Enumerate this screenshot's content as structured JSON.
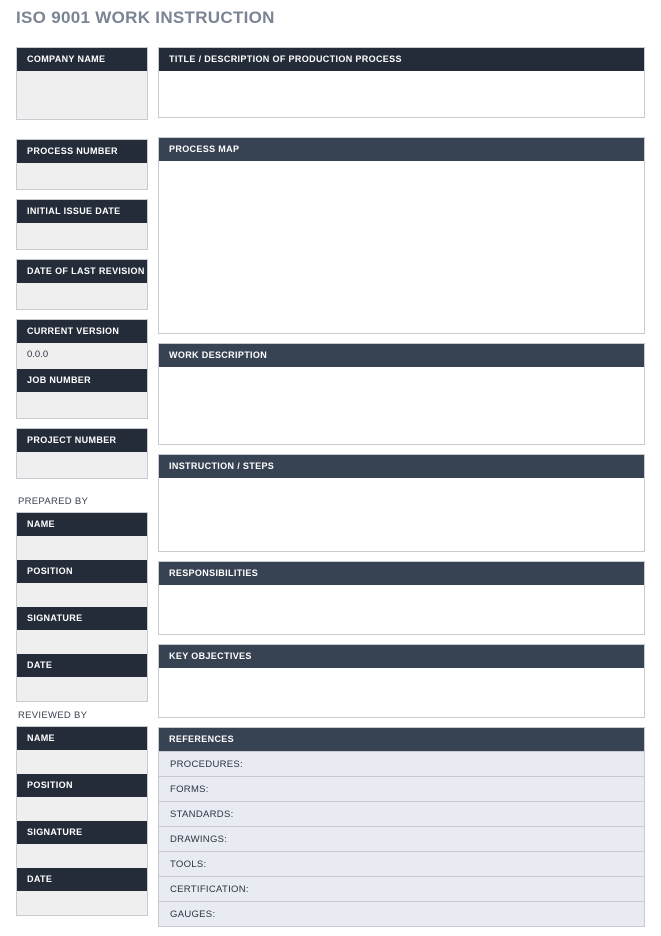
{
  "document": {
    "title": "ISO 9001 WORK INSTRUCTION"
  },
  "left_column": {
    "company": {
      "header": "COMPANY NAME",
      "value": ""
    },
    "fields": [
      {
        "header": "PROCESS NUMBER",
        "value": ""
      },
      {
        "header": "INITIAL ISSUE DATE",
        "value": ""
      },
      {
        "header": "DATE OF LAST REVISION",
        "value": ""
      },
      {
        "header": "CURRENT VERSION",
        "value": "0.0.0"
      },
      {
        "header": "JOB NUMBER",
        "value": ""
      },
      {
        "header": "PROJECT NUMBER",
        "value": ""
      }
    ],
    "prepared_by": {
      "label": "PREPARED BY",
      "rows": [
        {
          "header": "NAME",
          "value": ""
        },
        {
          "header": "POSITION",
          "value": ""
        },
        {
          "header": "SIGNATURE",
          "value": ""
        },
        {
          "header": "DATE",
          "value": ""
        }
      ]
    },
    "reviewed_by": {
      "label": "REVIEWED BY",
      "rows": [
        {
          "header": "NAME",
          "value": ""
        },
        {
          "header": "POSITION",
          "value": ""
        },
        {
          "header": "SIGNATURE",
          "value": ""
        },
        {
          "header": "DATE",
          "value": ""
        }
      ]
    }
  },
  "right_column": {
    "sections": [
      {
        "header": "TITLE / DESCRIPTION OF PRODUCTION PROCESS",
        "value": ""
      },
      {
        "header": "PROCESS MAP",
        "value": ""
      },
      {
        "header": "WORK DESCRIPTION",
        "value": ""
      },
      {
        "header": "INSTRUCTION / STEPS",
        "value": ""
      },
      {
        "header": "RESPONSIBILITIES",
        "value": ""
      },
      {
        "header": "KEY OBJECTIVES",
        "value": ""
      }
    ],
    "references": {
      "header": "REFERENCES",
      "rows": [
        {
          "label": "PROCEDURES:",
          "value": ""
        },
        {
          "label": "FORMS:",
          "value": ""
        },
        {
          "label": "STANDARDS:",
          "value": ""
        },
        {
          "label": "DRAWINGS:",
          "value": ""
        },
        {
          "label": "TOOLS:",
          "value": ""
        },
        {
          "label": "CERTIFICATION:",
          "value": ""
        },
        {
          "label": "GAUGES:",
          "value": ""
        }
      ]
    }
  },
  "colors": {
    "header_dark": "#242b39",
    "header_light": "#374253",
    "title_text": "#7b8493",
    "field_fill": "#efeff0",
    "reference_fill": "#e8ebf2",
    "border": "#c8cbd2"
  }
}
